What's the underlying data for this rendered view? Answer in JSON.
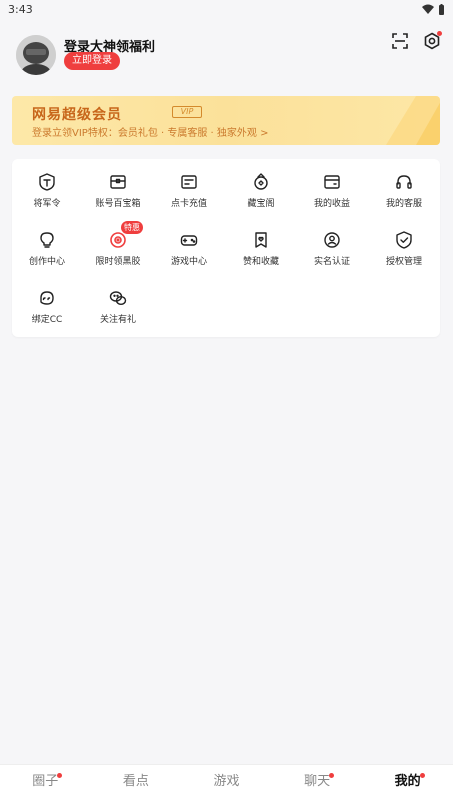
{
  "status": {
    "time": "3:43"
  },
  "header": {
    "title": "登录大神领福利",
    "login_button": "立即登录"
  },
  "vip": {
    "title": "网易超级会员",
    "badge": "VIP",
    "subtitle": "登录立领VIP特权：会员礼包 · 专属客服 · 独家外观  >"
  },
  "grid": {
    "items": [
      {
        "label": "将军令",
        "icon": "token-icon"
      },
      {
        "label": "账号百宝箱",
        "icon": "box-icon"
      },
      {
        "label": "点卡充值",
        "icon": "card-icon"
      },
      {
        "label": "藏宝阁",
        "icon": "treasure-icon"
      },
      {
        "label": "我的收益",
        "icon": "wallet-icon"
      },
      {
        "label": "我的客服",
        "icon": "headset-icon"
      },
      {
        "label": "创作中心",
        "icon": "bulb-icon"
      },
      {
        "label": "限时领黑胶",
        "icon": "vinyl-icon",
        "badge": "特惠"
      },
      {
        "label": "游戏中心",
        "icon": "gamepad-icon"
      },
      {
        "label": "赞和收藏",
        "icon": "bookmark-heart-icon"
      },
      {
        "label": "实名认证",
        "icon": "user-verify-icon"
      },
      {
        "label": "授权管理",
        "icon": "shield-check-icon"
      },
      {
        "label": "绑定CC",
        "icon": "cc-icon"
      },
      {
        "label": "关注有礼",
        "icon": "wechat-icon"
      }
    ]
  },
  "tabs": [
    {
      "label": "圈子",
      "dot": true
    },
    {
      "label": "看点",
      "dot": false
    },
    {
      "label": "游戏",
      "dot": false
    },
    {
      "label": "聊天",
      "dot": true
    },
    {
      "label": "我的",
      "dot": true,
      "active": true
    }
  ],
  "colors": {
    "accent": "#ef3e3e",
    "vip_text": "#c7661a",
    "vip_bg": "#fbe19a"
  }
}
